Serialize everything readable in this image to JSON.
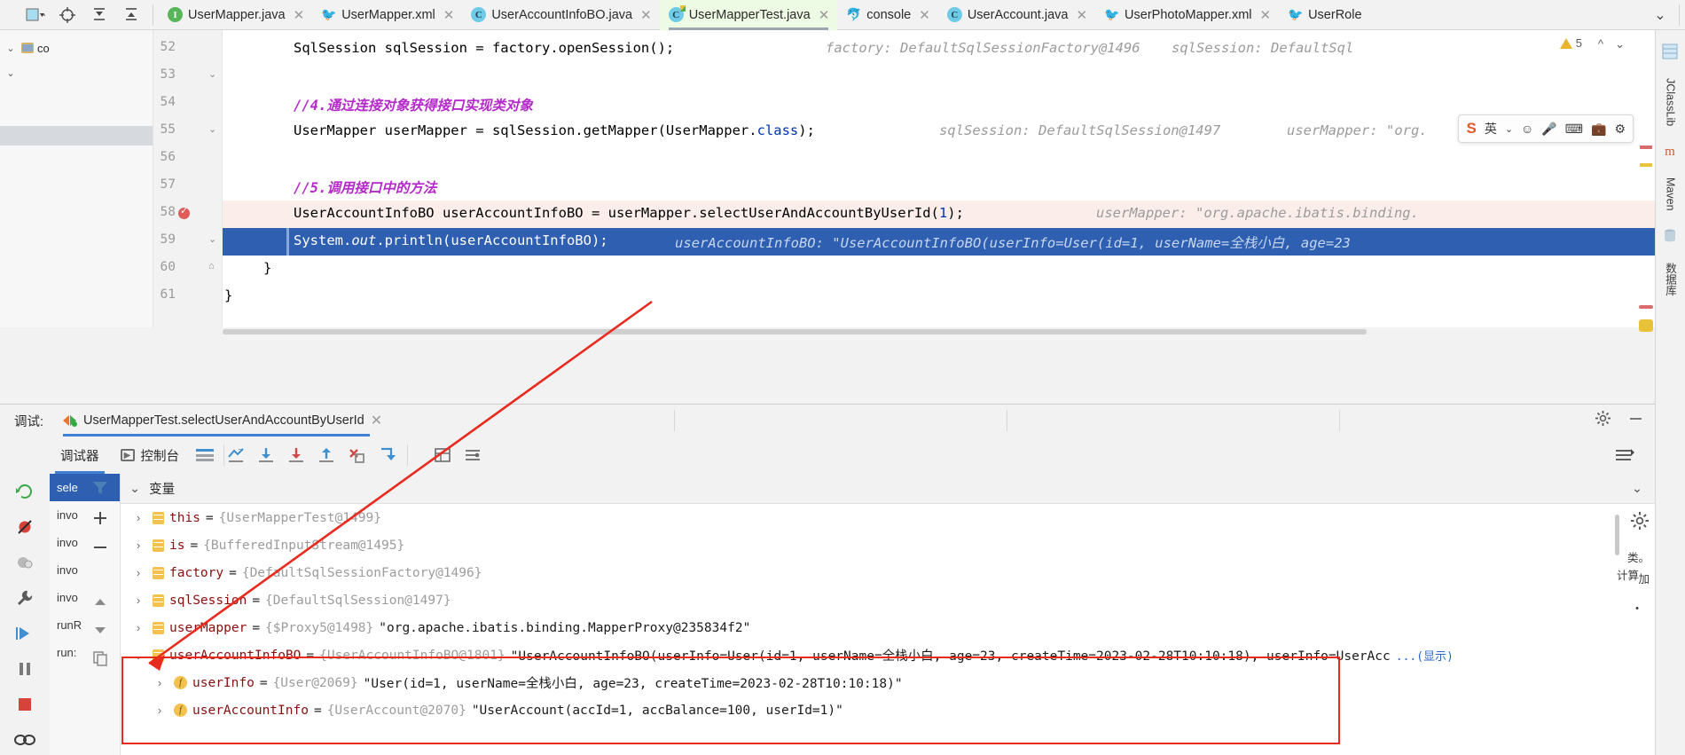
{
  "window": {
    "editor_tabs": [
      {
        "label": "UserMapper.java",
        "icon": "java-interface-icon",
        "active": false,
        "closable": true
      },
      {
        "label": "UserMapper.xml",
        "icon": "mybatis-bird-icon",
        "active": false,
        "closable": true
      },
      {
        "label": "UserAccountInfoBO.java",
        "icon": "java-class-icon",
        "active": false,
        "closable": true
      },
      {
        "label": "UserMapperTest.java",
        "icon": "java-class-modified-icon",
        "active": true,
        "closable": true
      },
      {
        "label": "console",
        "icon": "mysql-console-icon",
        "active": false,
        "closable": true
      },
      {
        "label": "UserAccount.java",
        "icon": "java-class-icon",
        "active": false,
        "closable": true
      },
      {
        "label": "UserPhotoMapper.xml",
        "icon": "mybatis-bird-icon",
        "active": false,
        "closable": true
      },
      {
        "label": "UserRole",
        "icon": "mybatis-bird-icon",
        "active": false,
        "closable": false
      }
    ],
    "tabs_overflow_label": "⌄",
    "nav_tools": [
      "project-widget-icon",
      "locate-icon",
      "expand-all-icon",
      "collapse-all-icon"
    ]
  },
  "right_strip": {
    "items": [
      {
        "label": "JClassLib",
        "name": "jclasslib-tool"
      },
      {
        "label": "Maven",
        "name": "maven-tool"
      },
      {
        "label": "数据库",
        "name": "database-tool"
      }
    ]
  },
  "project_pane": {
    "rows": [
      {
        "label": "co",
        "indent": 0
      }
    ]
  },
  "editor": {
    "warning_count": "5",
    "warning_icon": "warning-triangle-icon",
    "lines": [
      {
        "num": "52",
        "code_html": "plain",
        "text": "SqlSession sqlSession = factory.openSession();",
        "hints": [
          "factory: DefaultSqlSessionFactory@1496",
          "sqlSession: DefaultSql"
        ],
        "state": "normal"
      },
      {
        "num": "53",
        "text": "",
        "hints": [],
        "state": "normal"
      },
      {
        "num": "54",
        "text": "//4.通过连接对象获得接口实现类对象",
        "hints": [],
        "state": "comment"
      },
      {
        "num": "55",
        "text": "UserMapper userMapper = sqlSession.getMapper(UserMapper.class);",
        "hints": [
          "sqlSession: DefaultSqlSession@1497",
          "userMapper: \"org."
        ],
        "state": "normal"
      },
      {
        "num": "56",
        "text": "",
        "hints": [],
        "state": "normal"
      },
      {
        "num": "57",
        "text": "//5.调用接口中的方法",
        "hints": [],
        "state": "comment"
      },
      {
        "num": "58",
        "text": "UserAccountInfoBO userAccountInfoBO = userMapper.selectUserAndAccountByUserId(1);",
        "hints": [
          "userMapper: \"org.apache.ibatis.binding."
        ],
        "state": "breakpoint"
      },
      {
        "num": "59",
        "text": "System.out.println(userAccountInfoBO);",
        "hints": [
          "userAccountInfoBO: \"UserAccountInfoBO(userInfo=User(id=1, userName=全栈小白, age=23"
        ],
        "state": "selected"
      },
      {
        "num": "60",
        "text": "}",
        "hints": [],
        "state": "normal"
      },
      {
        "num": "61",
        "text": "}",
        "hints": [],
        "state": "normal"
      }
    ],
    "line58_parts": {
      "pre": "UserAccountInfoBO userAccountInfoBO = userMapper.selectUserAndAccountByUserId(",
      "num": "1",
      "post": ");"
    },
    "line59_parts": {
      "a": "System.",
      "b": "out",
      "c": ".println(userAccountInfoBO);"
    },
    "line52_parts": {
      "a": "SqlSession sqlSession = factory.openSession();"
    },
    "line55_parts": {
      "a": "UserMapper userMapper = sqlSession.getMapper(UserMapper.",
      "b": "class",
      "c": ");"
    }
  },
  "ime": {
    "lang": "英",
    "items": [
      "dropdown-icon",
      "smiley-icon",
      "mic-icon",
      "keyboard-icon",
      "toolbox-icon",
      "settings-icon"
    ]
  },
  "debug": {
    "title": "调试:",
    "session_name": "UserMapperTest.selectUserAndAccountByUserId",
    "close_label": "✕",
    "settings_icon": "gear-icon",
    "minimize_icon": "minimize-icon",
    "tabs": [
      {
        "label": "调试器",
        "selected": true,
        "icon": "debugger-icon"
      },
      {
        "label": "控制台",
        "selected": false,
        "icon": "console-icon"
      }
    ],
    "toolbar_icons": [
      "show-execution-point-icon",
      "step-over-icon",
      "step-into-icon",
      "force-step-into-icon",
      "step-out-icon",
      "drop-frame-icon",
      "run-to-cursor-icon",
      "evaluate-expression-icon",
      "layout-icon"
    ],
    "left_icons": [
      "rerun-icon",
      "mute-breakpoints-icon",
      "view-breakpoints-icon",
      "settings-wrench-icon",
      "resume-icon",
      "pause-icon",
      "stop-icon",
      "thread-icon"
    ],
    "frames": [
      {
        "label": "sele",
        "selected": true
      },
      {
        "label": "invo",
        "selected": false
      },
      {
        "label": "invo",
        "selected": false
      },
      {
        "label": "invo",
        "selected": false
      },
      {
        "label": "invo",
        "selected": false
      },
      {
        "label": "runR",
        "selected": false
      },
      {
        "label": "run:",
        "selected": false
      }
    ],
    "vars_header": "变量",
    "vars_collapse_icon": "chevron-down-icon",
    "vars_expand_right_icon": "chevron-down-icon",
    "side_labels": [
      "计算",
      "类。",
      "加"
    ],
    "variables": [
      {
        "chev": "›",
        "icon": "object-icon",
        "name": "this",
        "type": "{UserMapperTest@1499}",
        "value": "",
        "indent": 0,
        "expanded": false
      },
      {
        "chev": "›",
        "icon": "object-icon",
        "name": "is",
        "type": "{BufferedInputStream@1495}",
        "value": "",
        "indent": 0,
        "expanded": false
      },
      {
        "chev": "›",
        "icon": "object-icon",
        "name": "factory",
        "type": "{DefaultSqlSessionFactory@1496}",
        "value": "",
        "indent": 0,
        "expanded": false
      },
      {
        "chev": "›",
        "icon": "object-icon",
        "name": "sqlSession",
        "type": "{DefaultSqlSession@1497}",
        "value": "",
        "indent": 0,
        "expanded": false
      },
      {
        "chev": "›",
        "icon": "object-icon",
        "name": "userMapper",
        "type": "{$Proxy5@1498}",
        "value": "\"org.apache.ibatis.binding.MapperProxy@235834f2\"",
        "indent": 0,
        "expanded": false
      },
      {
        "chev": "⌄",
        "icon": "object-icon",
        "name": "userAccountInfoBO",
        "type": "{UserAccountInfoBO@1801}",
        "value": "\"UserAccountInfoBO(userInfo=User(id=1, userName=全栈小白, age=23, createTime=2023-02-28T10:10:18), userInfo=UserAcc",
        "value_suffix": "...(显示)",
        "indent": 0,
        "expanded": true
      },
      {
        "chev": "›",
        "icon": "field-icon",
        "name": "userInfo",
        "type": "{User@2069}",
        "value": "\"User(id=1, userName=全栈小白, age=23, createTime=2023-02-28T10:10:18)\"",
        "indent": 1,
        "expanded": false
      },
      {
        "chev": "›",
        "icon": "field-icon",
        "name": "userAccountInfo",
        "type": "{UserAccount@2070}",
        "value": "\"UserAccount(accId=1, accBalance=100, userId=1)\"",
        "indent": 1,
        "expanded": false
      }
    ]
  },
  "annotation": {
    "box_color": "#e82b1e",
    "arrow_color": "#e82b1e"
  }
}
